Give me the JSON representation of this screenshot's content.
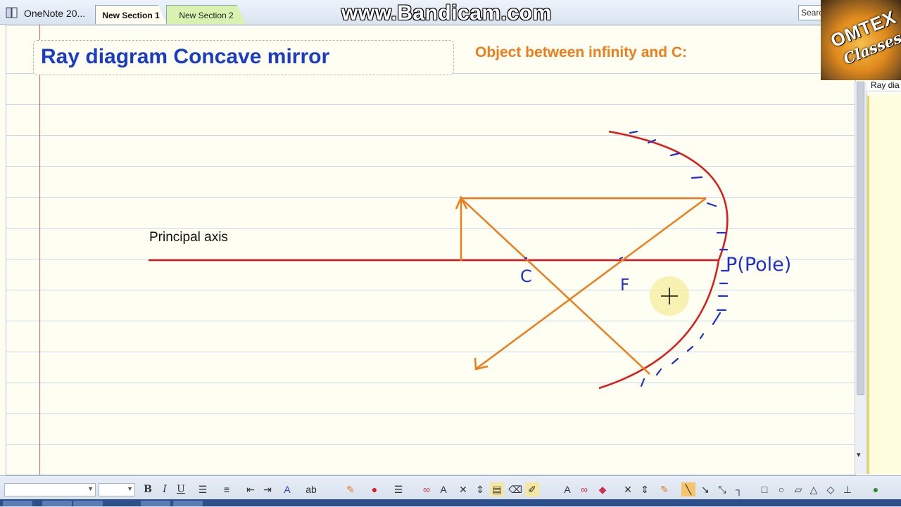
{
  "window": {
    "notebook_label": "OneNote 20...",
    "sections": [
      "New Section 1",
      "New Section 2"
    ],
    "search_placeholder": "Searc",
    "watermark": "www.Bandicam.com"
  },
  "logo": {
    "line1": "OMTEX",
    "line2": "Classes"
  },
  "page": {
    "title": "Ray diagram Concave mirror",
    "subtitle": "Object between infinity and C:",
    "axis_label": "Principal axis",
    "labels": {
      "c": "C",
      "f": "F",
      "pole": "P(Pole)"
    }
  },
  "page_list": {
    "active_page": "Ray dia"
  },
  "colors": {
    "title": "#1a3cc8",
    "subtitle": "#f07c1a",
    "axis": "#e01818",
    "mirror": "#e01818",
    "rays": "#f07c1a",
    "ink_blue": "#1f2fd0"
  },
  "toolbar": {
    "bold": "B",
    "italic": "I",
    "underline": "U",
    "icons": [
      "bullets-icon",
      "numbering-icon",
      "outdent-icon",
      "indent-icon",
      "font-color-icon",
      "highlight-icon",
      "pen-icon",
      "color-icon",
      "line-weight-icon",
      "lasso-icon",
      "type-icon",
      "eraser-icon",
      "delete-icon",
      "insert-space-icon",
      "note-container-icon",
      "line-icon",
      "arrow-icon",
      "double-arrow-icon",
      "rectangle-icon",
      "ellipse-icon",
      "parallelogram-icon",
      "triangle-icon",
      "diamond-icon",
      "axes-icon"
    ]
  }
}
